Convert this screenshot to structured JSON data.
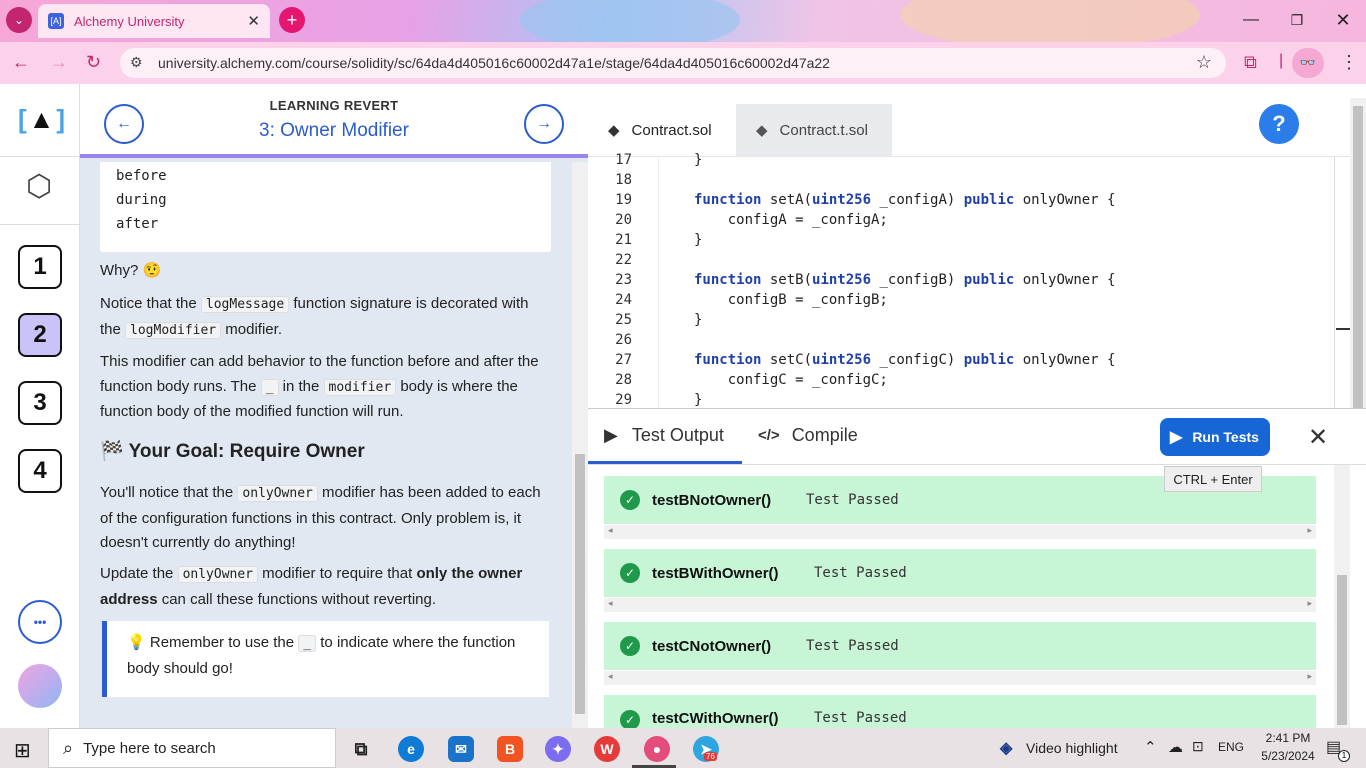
{
  "browser": {
    "tab_title": "Alchemy University",
    "tab_favicon": "[A]",
    "url": "university.alchemy.com/course/solidity/sc/64da4d405016c60002d47a1e/stage/64da4d405016c60002d47a22"
  },
  "rail": {
    "stages": [
      "1",
      "2",
      "3",
      "4"
    ],
    "active_stage": "2",
    "more_label": "•••"
  },
  "lesson": {
    "section": "LEARNING REVERT",
    "title": "3: Owner Modifier",
    "code_lines": [
      "before",
      "during",
      "after"
    ],
    "why": "Why? 🤨",
    "p1_a": "Notice that the ",
    "p1_code1": "logMessage",
    "p1_b": " function signature is decorated with the ",
    "p1_code2": "logModifier",
    "p1_c": " modifier.",
    "p2_a": "This modifier can add behavior to the function before and after the function body runs. The ",
    "p2_code1": "_",
    "p2_b": " in the ",
    "p2_code2": "modifier",
    "p2_c": " body is where the function body of the modified function will run.",
    "goal_icon": "🏁",
    "goal": "Your Goal: Require Owner",
    "p3_a": "You'll notice that the ",
    "p3_code": "onlyOwner",
    "p3_b": " modifier has been added to each of the configuration functions in this contract. Only problem is, it doesn't currently do anything!",
    "p4_a": "Update the ",
    "p4_code": "onlyOwner",
    "p4_b": " modifier to require that ",
    "p4_bold": "only the owner address",
    "p4_c": " can call these functions without reverting.",
    "tip_icon": "💡",
    "tip_a": "Remember to use the ",
    "tip_code": "_",
    "tip_b": " to indicate where the function body should go!"
  },
  "editor": {
    "tabs": [
      "Contract.sol",
      "Contract.t.sol"
    ],
    "help": "?",
    "lines": [
      {
        "n": "17",
        "t": "}"
      },
      {
        "n": "18",
        "t": ""
      },
      {
        "n": "19",
        "kw": "function",
        "t": " setA(",
        "kw2": "uint256",
        "t2": " _configA) ",
        "kw3": "public",
        "t3": " onlyOwner {"
      },
      {
        "n": "20",
        "t": "    configA = _configA;"
      },
      {
        "n": "21",
        "t": "}"
      },
      {
        "n": "22",
        "t": ""
      },
      {
        "n": "23",
        "kw": "function",
        "t": " setB(",
        "kw2": "uint256",
        "t2": " _configB) ",
        "kw3": "public",
        "t3": " onlyOwner {"
      },
      {
        "n": "24",
        "t": "    configB = _configB;"
      },
      {
        "n": "25",
        "t": "}"
      },
      {
        "n": "26",
        "t": ""
      },
      {
        "n": "27",
        "kw": "function",
        "t": " setC(",
        "kw2": "uint256",
        "t2": " _configC) ",
        "kw3": "public",
        "t3": " onlyOwner {"
      },
      {
        "n": "28",
        "t": "    configC = _configC;"
      },
      {
        "n": "29",
        "t": "}"
      }
    ]
  },
  "output": {
    "tab_test": "Test Output",
    "tab_compile": "Compile",
    "run_label": "Run Tests",
    "tooltip": "CTRL + Enter",
    "results": [
      {
        "name": "testBNotOwner()",
        "status": "Test Passed"
      },
      {
        "name": "testBWithOwner()",
        "status": "Test Passed"
      },
      {
        "name": "testCNotOwner()",
        "status": "Test Passed"
      },
      {
        "name": "testCWithOwner()",
        "status": "Test Passed"
      }
    ]
  },
  "taskbar": {
    "search_placeholder": "Type here to search",
    "news": "Video highlight",
    "lang": "ENG",
    "time": "2:41 PM",
    "date": "5/23/2024",
    "notif_count": "1",
    "telegram_badge": "76"
  }
}
